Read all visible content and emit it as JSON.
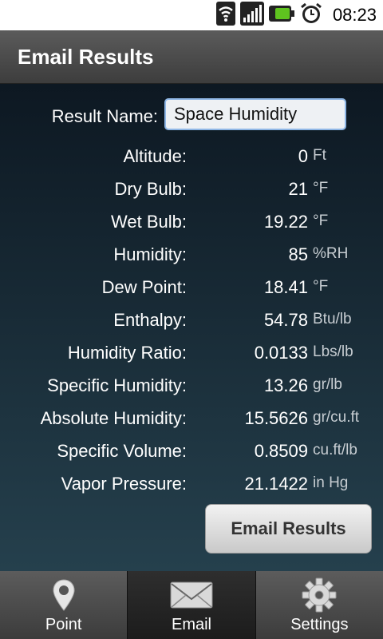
{
  "status_bar": {
    "time": "08:23"
  },
  "header": {
    "title": "Email Results"
  },
  "form": {
    "result_name_label": "Result Name:",
    "result_name_value": "Space Humidity"
  },
  "results": [
    {
      "label": "Altitude:",
      "value": "0",
      "unit": "Ft"
    },
    {
      "label": "Dry Bulb:",
      "value": "21",
      "unit": "°F"
    },
    {
      "label": "Wet Bulb:",
      "value": "19.22",
      "unit": "°F"
    },
    {
      "label": "Humidity:",
      "value": "85",
      "unit": "%RH"
    },
    {
      "label": "Dew Point:",
      "value": "18.41",
      "unit": "°F"
    },
    {
      "label": "Enthalpy:",
      "value": "54.78",
      "unit": "Btu/lb"
    },
    {
      "label": "Humidity Ratio:",
      "value": "0.0133",
      "unit": "Lbs/lb"
    },
    {
      "label": "Specific Humidity:",
      "value": "13.26",
      "unit": "gr/lb"
    },
    {
      "label": "Absolute Humidity:",
      "value": "15.5626",
      "unit": "gr/cu.ft"
    },
    {
      "label": "Specific Volume:",
      "value": "0.8509",
      "unit": "cu.ft/lb"
    },
    {
      "label": "Vapor Pressure:",
      "value": "21.1422",
      "unit": "in Hg"
    }
  ],
  "email_button_label": "Email Results",
  "tabs": [
    {
      "label": "Point",
      "icon": "map-pin-icon",
      "active": false
    },
    {
      "label": "Email",
      "icon": "envelope-icon",
      "active": true
    },
    {
      "label": "Settings",
      "icon": "gear-icon",
      "active": false
    }
  ],
  "colors": {
    "input_border": "#8fb7e6",
    "background_top": "#0d1822",
    "background_bottom": "#25404d"
  }
}
